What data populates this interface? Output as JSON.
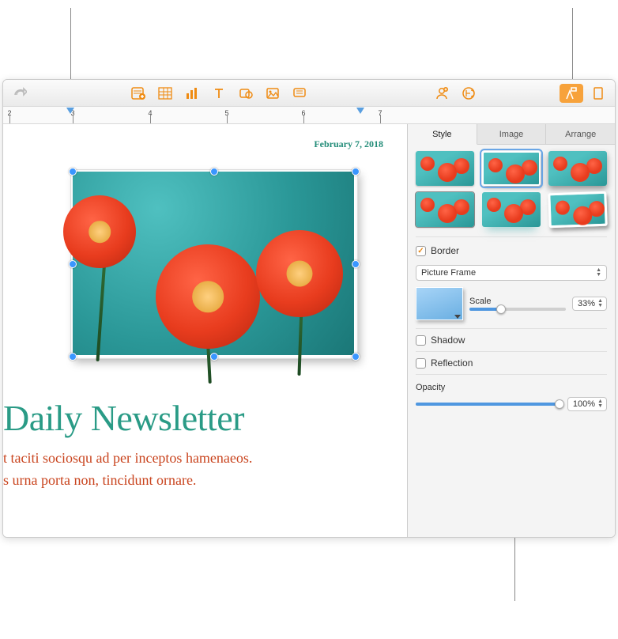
{
  "toolbar": {
    "redo": "redo",
    "insert": "insert",
    "table": "table",
    "chart": "chart",
    "text": "text",
    "shape": "shape",
    "media": "media",
    "comment": "comment",
    "collaborate": "collaborate",
    "tips": "tips",
    "format": "format",
    "document": "document"
  },
  "ruler": {
    "marks": [
      "2",
      "3",
      "4",
      "5",
      "6",
      "7"
    ]
  },
  "document": {
    "date": "February 7, 2018",
    "headline": "Daily Newsletter",
    "line1": "t taciti sociosqu ad per inceptos hamenaeos.",
    "line2": "s urna porta non, tincidunt ornare."
  },
  "inspector": {
    "tabs": {
      "style": "Style",
      "image": "Image",
      "arrange": "Arrange"
    },
    "border": {
      "label": "Border",
      "checked": true,
      "type": "Picture Frame",
      "scale_label": "Scale",
      "scale_value": "33%"
    },
    "shadow": {
      "label": "Shadow",
      "checked": false
    },
    "reflection": {
      "label": "Reflection",
      "checked": false
    },
    "opacity": {
      "label": "Opacity",
      "value": "100%"
    }
  }
}
